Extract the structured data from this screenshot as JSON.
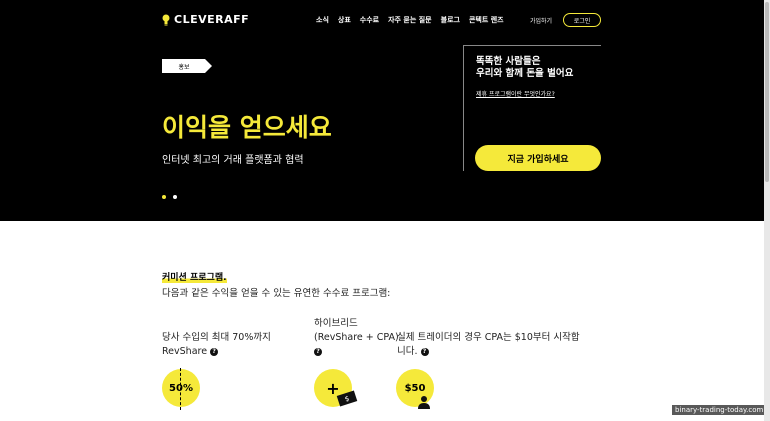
{
  "brand": {
    "name": "CLEVERAFF",
    "accent": "#f5e93a"
  },
  "nav": {
    "items": [
      "소식",
      "상표",
      "수수료",
      "자주 묻는 질문",
      "블로그",
      "콘텍트 렌즈"
    ],
    "join": "가입하기",
    "login": "로그인"
  },
  "hero": {
    "tag": "홍보",
    "title": "이익을 얻으세요",
    "subtitle": "인터넷 최고의 거래 플랫폼과 협력",
    "side_heading_1": "똑똑한 사람들은",
    "side_heading_2": "우리와 함께 돈을 벌어요",
    "side_link": "제휴 프로그램이란 무엇인가요?",
    "cta": "지금 가입하세요"
  },
  "commission": {
    "title": "커미션 프로그램.",
    "description": "다음과 같은 수익을 얻을 수 있는 유연한 수수료 프로그램:",
    "features": [
      {
        "line1": "당사 수입의 최대 70%까지",
        "line2": "RevShare",
        "badge": "50%"
      },
      {
        "line1": "하이브리드",
        "line2": "(RevShare + CPA)",
        "badge": "+"
      },
      {
        "line1": "실제 트레이더의 경우 CPA는 $10부터 시작합",
        "line2": "니다.",
        "badge": "$50"
      }
    ],
    "help_icon": "?",
    "cash_icon": "$"
  },
  "watermark": "binary-trading-today.com"
}
